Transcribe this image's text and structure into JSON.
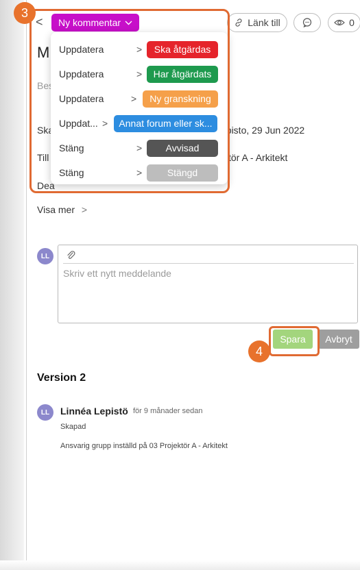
{
  "header": {
    "back_glyph": "<",
    "new_comment_label": "Ny kommentar",
    "link_label": "Länk till",
    "watchers_count": "0"
  },
  "annotations": {
    "badge_dropdown": "3",
    "badge_save": "4"
  },
  "dropdown": {
    "items": [
      {
        "action": "Uppdatera",
        "status": "Ska åtgärdas",
        "color": "#e5242b"
      },
      {
        "action": "Uppdatera",
        "status": "Har åtgärdats",
        "color": "#1e9a4e"
      },
      {
        "action": "Uppdatera",
        "status": "Ny granskning",
        "color": "#f5a04a"
      },
      {
        "action": "Uppdat...",
        "status": "Annat forum eller sk...",
        "color": "#2d8de0"
      },
      {
        "action": "Stäng",
        "status": "Avvisad",
        "color": "#555555"
      },
      {
        "action": "Stäng",
        "status": "Stängd",
        "color": "#bdbdbd"
      }
    ]
  },
  "background_form": {
    "title_fragment": "M",
    "desc_fragment": "Bes",
    "created_fragment": "Ska",
    "created_value_fragment": "episto, 29 Jun 2022",
    "assigned_fragment": "Till",
    "assigned_value_fragment": "ktör A - Arkitekt",
    "deadline_fragment": "Dea"
  },
  "visa_mer": "Visa mer",
  "comment": {
    "avatar_initials": "LL",
    "placeholder": "Skriv ett nytt meddelande",
    "save_label": "Spara",
    "cancel_label": "Avbryt"
  },
  "history": {
    "version_title": "Version 2",
    "avatar_initials": "LL",
    "author": "Linnéa Lepistö",
    "time": "för 9 månader sedan",
    "created": "Skapad",
    "detail": "Ansvarig grupp inställd på 03 Projektör A - Arkitekt"
  }
}
